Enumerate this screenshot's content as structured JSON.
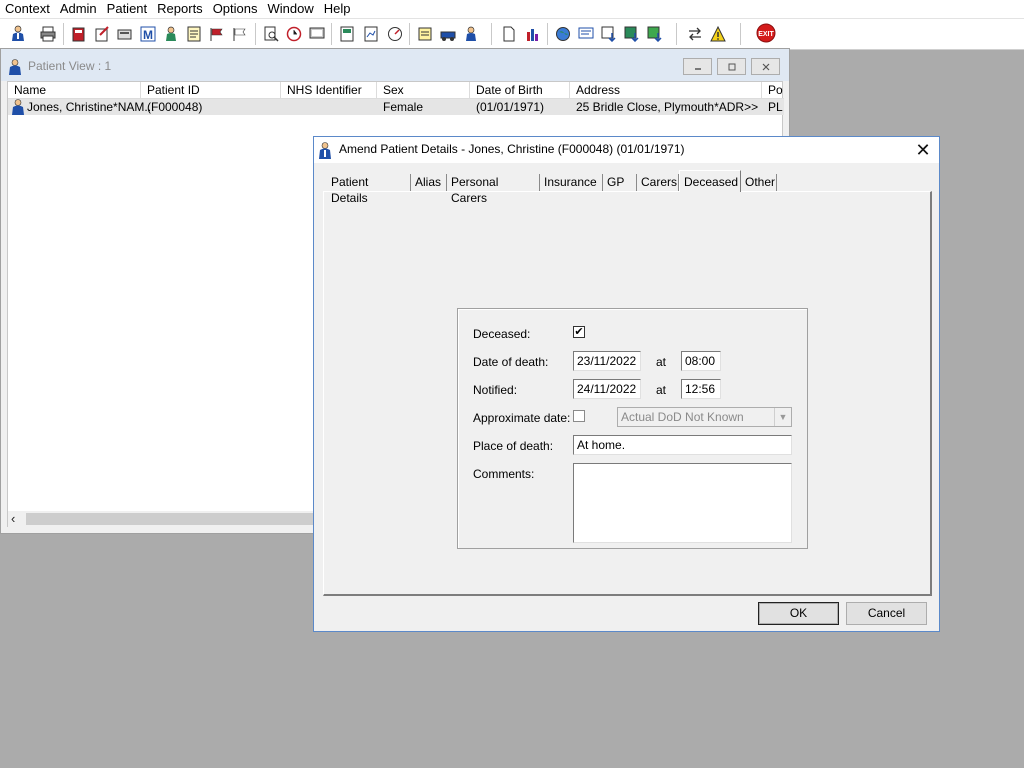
{
  "menu": [
    "Context",
    "Admin",
    "Patient",
    "Reports",
    "Options",
    "Window",
    "Help"
  ],
  "toolbar": {
    "icons": [
      "patient-icon",
      "print-icon",
      "book-icon",
      "notes-icon",
      "scanner-icon",
      "mail-icon",
      "doctor-icon",
      "form-icon",
      "flag-icon",
      "flag-alt-icon",
      "search-doc-icon",
      "clock-icon",
      "monitor-icon",
      "report-icon",
      "chart-icon",
      "dial-icon",
      "edit-icon",
      "car-icon",
      "person-icon",
      "document-icon",
      "bar-chart-icon",
      "globe-icon",
      "message-icon",
      "download-icon",
      "map-icon",
      "tree-icon",
      "transfer-icon",
      "warning-icon",
      "exit-icon"
    ],
    "exit_label": "EXIT"
  },
  "patient_view": {
    "title": "Patient View : 1",
    "columns": [
      "Name",
      "Patient ID",
      "NHS Identifier",
      "Sex",
      "Date of Birth",
      "Address",
      "Po"
    ],
    "rows": [
      {
        "name": "Jones, Christine*NAM...",
        "patient_id": "(F000048)",
        "nhs": "",
        "sex": "Female",
        "dob": "(01/01/1971)",
        "address": "25 Bridle Close, Plymouth*ADR>>",
        "po": "PL"
      }
    ],
    "scroll_left": "‹"
  },
  "dialog": {
    "title": "Amend Patient Details - Jones, Christine (F000048) (01/01/1971)",
    "close": "✕",
    "tabs": [
      "Patient Details",
      "Alias",
      "Personal Carers",
      "Insurance",
      "GP",
      "Carers",
      "Deceased",
      "Other"
    ],
    "active_tab": "Deceased",
    "deceased": {
      "deceased_label": "Deceased:",
      "deceased_checked": true,
      "date_of_death_label": "Date of death:",
      "date_of_death": "23/11/2022",
      "at_label": "at",
      "time_of_death": "08:00",
      "notified_label": "Notified:",
      "notified_date": "24/11/2022",
      "notified_time": "12:56",
      "approx_label": "Approximate date:",
      "approx_checked": false,
      "approx_option": "Actual DoD Not Known",
      "place_label": "Place of death:",
      "place": "At home.",
      "comments_label": "Comments:",
      "comments": ""
    },
    "ok": "OK",
    "cancel": "Cancel"
  }
}
